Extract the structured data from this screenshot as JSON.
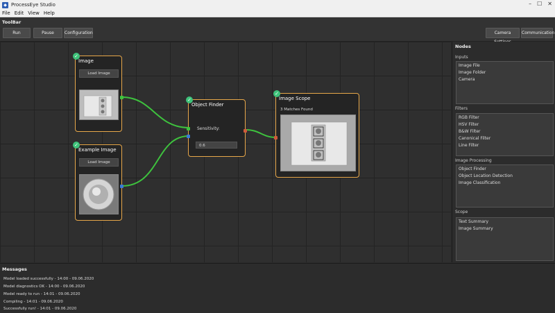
{
  "window": {
    "title": "ProcessEye Studio",
    "controls": [
      "–",
      "☐",
      "✕"
    ]
  },
  "menu": [
    "File",
    "Edit",
    "View",
    "Help"
  ],
  "toolbar": {
    "label": "ToolBar",
    "run": "Run",
    "pause": "Pause",
    "configuration": "Configuration",
    "camera_settings": "Camera Settings",
    "communication": "Communication"
  },
  "nodes": {
    "image": {
      "title": "Image",
      "button": "Load Image"
    },
    "example_image": {
      "title": "Example Image",
      "button": "Load Image"
    },
    "object_finder": {
      "title": "Object Finder",
      "sensitivity_label": "Sensitivity:",
      "sensitivity_value": "0.6"
    },
    "image_scope": {
      "title": "Image Scope",
      "matches": "3 Matches Found"
    }
  },
  "side_panel": {
    "title": "Nodes",
    "sections": [
      {
        "title": "Inputs",
        "items": [
          "Image File",
          "Image Folder",
          "Camera"
        ]
      },
      {
        "title": "Filters",
        "items": [
          "RGB Filter",
          "HSV Filter",
          "B&W Filter",
          "Canonical Filter",
          "Line Filter"
        ]
      },
      {
        "title": "Image Processing",
        "items": [
          "Object Finder",
          "Object Location Detection",
          "Image Classification"
        ]
      },
      {
        "title": "Scope",
        "items": [
          "Text Summary",
          "Image Summary"
        ]
      }
    ]
  },
  "messages": {
    "title": "Messages",
    "lines": [
      "Model loaded successfully - 14:00 - 09.06.2020",
      "Model diagnostics OK - 14:00 - 09.06.2020",
      "Model ready to run - 14:01 - 09.06.2020",
      "Compiling - 14:01 - 09.06.2020",
      "Successfully run! - 14:01 - 09.06.2020"
    ]
  },
  "colors": {
    "node_border": "#e8a84a",
    "check": "#3ec27a",
    "wire": "#3ec23e",
    "port_green": "#3ec23e",
    "port_blue": "#3a7bd5",
    "port_red": "#d05a3a"
  },
  "icons": {
    "app": "eye-logo-icon",
    "check": "check-icon"
  }
}
